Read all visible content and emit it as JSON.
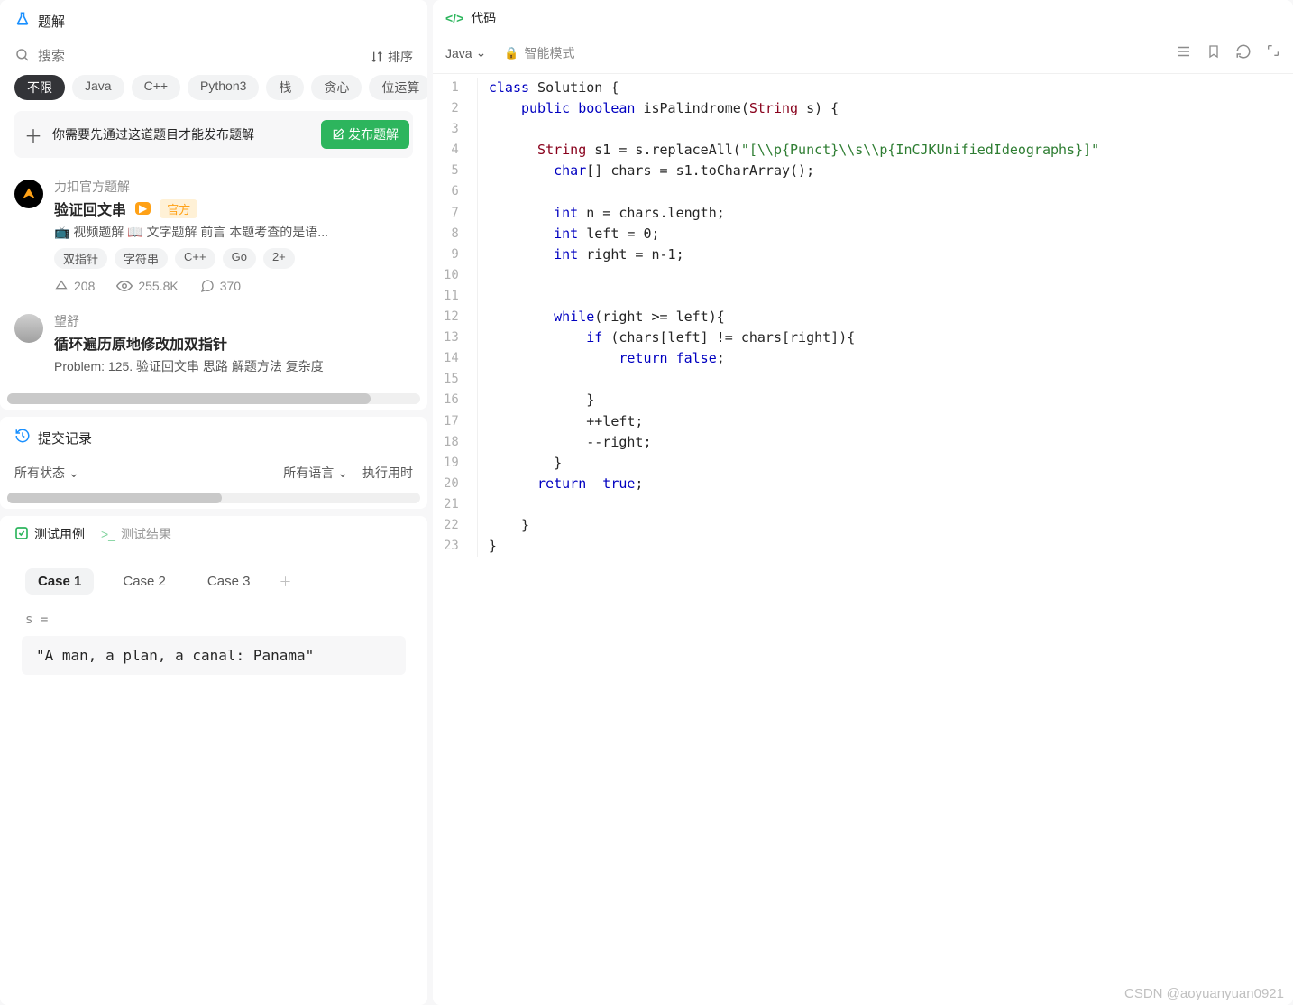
{
  "left": {
    "title": "题解",
    "search_placeholder": "搜索",
    "sort_label": "排序",
    "filters": [
      "不限",
      "Java",
      "C++",
      "Python3",
      "栈",
      "贪心",
      "位运算"
    ],
    "active_filter": 0,
    "publish_hint": "你需要先通过这道题目才能发布题解",
    "publish_btn": "发布题解",
    "solutions": [
      {
        "author": "力扣官方题解",
        "title": "验证回文串",
        "official": "官方",
        "has_video": true,
        "desc": "📺 视频题解 📖 文字题解 前言 本题考查的是语...",
        "tags": [
          "双指针",
          "字符串",
          "C++",
          "Go",
          "2+"
        ],
        "upvotes": "208",
        "views": "255.8K",
        "comments": "370"
      },
      {
        "author": "望舒",
        "title": "循环遍历原地修改加双指针",
        "desc": "Problem: 125. 验证回文串 思路 解题方法 复杂度"
      }
    ]
  },
  "submission": {
    "title": "提交记录",
    "status_label": "所有状态",
    "lang_label": "所有语言",
    "time_label": "执行用时"
  },
  "testcase": {
    "tab_cases": "测试用例",
    "tab_results": "测试结果",
    "cases": [
      "Case 1",
      "Case 2",
      "Case 3"
    ],
    "active_case": 0,
    "var_label": "s =",
    "value": "\"A man, a plan, a canal: Panama\""
  },
  "code_panel": {
    "title": "代码",
    "language": "Java",
    "smart_mode": "智能模式",
    "lines": [
      [
        [
          "kw",
          "class"
        ],
        [
          "",
          " Solution {"
        ]
      ],
      [
        [
          "",
          "    "
        ],
        [
          "kw",
          "public"
        ],
        [
          "",
          " "
        ],
        [
          "kw",
          "boolean"
        ],
        [
          "",
          " isPalindrome("
        ],
        [
          "type",
          "String"
        ],
        [
          "",
          " s) {"
        ]
      ],
      [
        [
          "",
          ""
        ]
      ],
      [
        [
          "",
          "      "
        ],
        [
          "type",
          "String"
        ],
        [
          "",
          " s1 = s.replaceAll("
        ],
        [
          "str",
          "\"[\\\\p{Punct}\\\\s\\\\p{InCJKUnifiedIdeographs}]\""
        ]
      ],
      [
        [
          "",
          "        "
        ],
        [
          "kw",
          "char"
        ],
        [
          "",
          "[] chars = s1.toCharArray();"
        ]
      ],
      [
        [
          "",
          ""
        ]
      ],
      [
        [
          "",
          "        "
        ],
        [
          "kw",
          "int"
        ],
        [
          "",
          " n = chars.length;"
        ]
      ],
      [
        [
          "",
          "        "
        ],
        [
          "kw",
          "int"
        ],
        [
          "",
          " left = 0;"
        ]
      ],
      [
        [
          "",
          "        "
        ],
        [
          "kw",
          "int"
        ],
        [
          "",
          " right = n-1;"
        ]
      ],
      [
        [
          "",
          ""
        ]
      ],
      [
        [
          "",
          ""
        ]
      ],
      [
        [
          "",
          "        "
        ],
        [
          "kw",
          "while"
        ],
        [
          "",
          "(right >= left){"
        ]
      ],
      [
        [
          "",
          "            "
        ],
        [
          "kw",
          "if"
        ],
        [
          "",
          " (chars[left] != chars[right]){"
        ]
      ],
      [
        [
          "",
          "                "
        ],
        [
          "kw",
          "return"
        ],
        [
          "",
          " "
        ],
        [
          "bool",
          "false"
        ],
        [
          "",
          ";"
        ]
      ],
      [
        [
          "",
          ""
        ]
      ],
      [
        [
          "",
          "            }"
        ]
      ],
      [
        [
          "",
          "            ++left;"
        ]
      ],
      [
        [
          "",
          "            --right;"
        ]
      ],
      [
        [
          "",
          "        }"
        ]
      ],
      [
        [
          "",
          "      "
        ],
        [
          "kw",
          "return"
        ],
        [
          "",
          "  "
        ],
        [
          "bool",
          "true"
        ],
        [
          "",
          ";"
        ]
      ],
      [
        [
          "",
          ""
        ]
      ],
      [
        [
          "",
          "    }"
        ]
      ],
      [
        [
          "",
          "}"
        ]
      ]
    ]
  },
  "watermark": "CSDN @aoyuanyuan0921"
}
